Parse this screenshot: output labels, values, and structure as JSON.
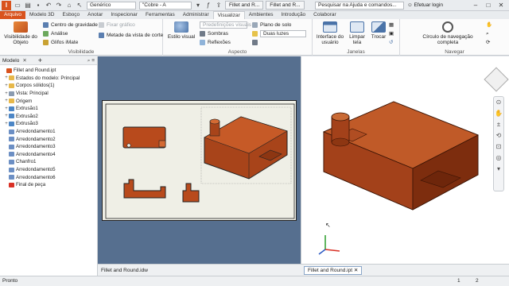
{
  "quick_access": {
    "template_value": "Genérico",
    "material_value": "\"Cobre - A"
  },
  "doc_tabs": [
    "Fillet and R...",
    "Fillet and R..."
  ],
  "search": {
    "placeholder": "Pesquisar na Ajuda e comandos..."
  },
  "login": "Efetuar login",
  "ribbon_tabs": [
    "Arquivo",
    "Modelo 3D",
    "Esboço",
    "Anotar",
    "Inspecionar",
    "Ferramentas",
    "Administrar",
    "Visualizar",
    "Ambientes",
    "Introdução",
    "Colaborar"
  ],
  "active_tab_index": 7,
  "ribbon": {
    "visibility": {
      "title": "Visibilidade",
      "object_visibility": "Visibilidade do Objeto",
      "center_of_gravity": "Centro de gravidade",
      "analysis": "Análise",
      "imate_glyphs": "Glifos iMate",
      "fix_graphic": "Fixar gráfico",
      "half_section": "Metade da vista de corte"
    },
    "appearance": {
      "title": "Aspecto",
      "visual_style": "Estilo visual",
      "visual_presets": "Predefinições visuais",
      "shadows": "Sombras",
      "reflections": "Reflexões",
      "ground_plane": "Plano de solo",
      "two_lights": "Duas luzes"
    },
    "windows": {
      "title": "Janelas",
      "user_interface": "Interface do usuário",
      "clean_screen": "Limpar tela",
      "switch": "Trocar"
    },
    "navigate": {
      "title": "Navegar",
      "full_nav_wheel": "Círculo de navegação completa"
    }
  },
  "browser": {
    "tab_label": "Modelo",
    "nodes": [
      {
        "label": "Fillet and Round.ipt",
        "expander": "",
        "color": "#d9531e",
        "indent": 0
      },
      {
        "label": "Estados do modelo: Principal",
        "expander": "+",
        "color": "#e7b84a",
        "indent": 1
      },
      {
        "label": "Corpos sólidos(1)",
        "expander": "+",
        "color": "#e7b84a",
        "indent": 1
      },
      {
        "label": "Vista: Principal",
        "expander": "+",
        "color": "#8a9bb0",
        "indent": 1
      },
      {
        "label": "Origem",
        "expander": "+",
        "color": "#e7b84a",
        "indent": 1
      },
      {
        "label": "Extrusão1",
        "expander": "+",
        "color": "#4c86c6",
        "indent": 1
      },
      {
        "label": "Extrusão2",
        "expander": "+",
        "color": "#4c86c6",
        "indent": 1
      },
      {
        "label": "Extrusão3",
        "expander": "+",
        "color": "#4c86c6",
        "indent": 1
      },
      {
        "label": "Arredondamento1",
        "expander": "",
        "color": "#6c8fc4",
        "indent": 1
      },
      {
        "label": "Arredondamento2",
        "expander": "",
        "color": "#6c8fc4",
        "indent": 1
      },
      {
        "label": "Arredondamento3",
        "expander": "",
        "color": "#6c8fc4",
        "indent": 1
      },
      {
        "label": "Arredondamento4",
        "expander": "",
        "color": "#6c8fc4",
        "indent": 1
      },
      {
        "label": "Chanfro1",
        "expander": "",
        "color": "#6c8fc4",
        "indent": 1
      },
      {
        "label": "Arredondamento5",
        "expander": "",
        "color": "#6c8fc4",
        "indent": 1
      },
      {
        "label": "Arredondamento6",
        "expander": "",
        "color": "#6c8fc4",
        "indent": 1
      },
      {
        "label": "Final de peça",
        "expander": "",
        "color": "#d93025",
        "indent": 1
      }
    ]
  },
  "drawing_tab": "Fillet and Round.idw",
  "part_tab": "Fillet and Round.ipt",
  "status": {
    "text": "Pronto",
    "page1": "1",
    "page2": "2"
  }
}
